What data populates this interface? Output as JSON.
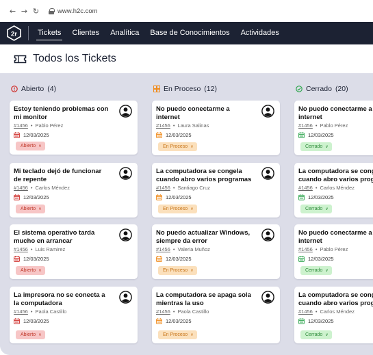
{
  "browser": {
    "back_icon": "arrow-left-icon",
    "forward_icon": "arrow-right-icon",
    "reload_icon": "reload-icon",
    "url": "www.h2c.com"
  },
  "navbar": {
    "logo_text": "2r",
    "items": [
      {
        "label": "Tickets",
        "active": true
      },
      {
        "label": "Clientes",
        "active": false
      },
      {
        "label": "Analítica",
        "active": false
      },
      {
        "label": "Base de Conocimientos",
        "active": false
      },
      {
        "label": "Actividades",
        "active": false
      }
    ]
  },
  "page": {
    "title": "Todos los Tickets",
    "title_icon": "ticket-icon"
  },
  "colors": {
    "navbar": "#1c2233",
    "board": "#dcdde8",
    "open": "#d0312d",
    "progress": "#f08c1e",
    "closed": "#34a853"
  },
  "columns": [
    {
      "title": "Abierto",
      "count": "(4)",
      "icon": "alert-circle-icon",
      "cards": [
        {
          "title": "Estoy teniendo problemas con mi monitor",
          "id": "#1456",
          "user": "Pablo Pérez",
          "date": "12/03/2025",
          "status": "Abierto"
        },
        {
          "title": "Mi teclado dejó de funcionar de repente",
          "id": "#1456",
          "user": "Carlos Méndez",
          "date": "12/03/2025",
          "status": "Abierto"
        },
        {
          "title": "El sistema operativo tarda mucho en arrancar",
          "id": "#1456",
          "user": "Luis Ramirez",
          "date": "12/03/2025",
          "status": "Abierto"
        },
        {
          "title": "La impresora no se conecta a la computadora",
          "id": "#1456",
          "user": "Paola Castillo",
          "date": "12/03/2025",
          "status": "Abierto"
        }
      ]
    },
    {
      "title": "En Proceso",
      "count": "(12)",
      "icon": "grid-squares-icon",
      "cards": [
        {
          "title": "No puedo conectarme a internet",
          "id": "#1456",
          "user": "Laura Salinas",
          "date": "12/03/2025",
          "status": "En Proceso"
        },
        {
          "title": "La computadora se congela cuando abro varios programas",
          "id": "#1456",
          "user": "Santiago Cruz",
          "date": "12/03/2025",
          "status": "En Proceso"
        },
        {
          "title": "No puedo actualizar Windows, siempre da error",
          "id": "#1456",
          "user": "Valeria Muñoz",
          "date": "12/03/2025",
          "status": "En Proceso"
        },
        {
          "title": "La computadora se apaga sola mientras la uso",
          "id": "#1456",
          "user": "Paola Castillo",
          "date": "12/03/2025",
          "status": "En Proceso"
        }
      ]
    },
    {
      "title": "Cerrado",
      "count": "(20)",
      "icon": "check-circle-icon",
      "cards": [
        {
          "title": "No puedo conectarme a internet",
          "id": "#1456",
          "user": "Pablo Pérez",
          "date": "12/03/2025",
          "status": "Cerrado"
        },
        {
          "title": "La computadora se congela cuando abro varios programas",
          "id": "#1456",
          "user": "Carlos Méndez",
          "date": "12/03/2025",
          "status": "Cerrado"
        },
        {
          "title": "No puedo conectarme a internet",
          "id": "#1456",
          "user": "Pablo Pérez",
          "date": "12/03/2025",
          "status": "Cerrado"
        },
        {
          "title": "La computadora se congela cuando abro varios programas",
          "id": "#1456",
          "user": "Carlos Méndez",
          "date": "12/03/2025",
          "status": "Cerrado"
        }
      ]
    }
  ]
}
